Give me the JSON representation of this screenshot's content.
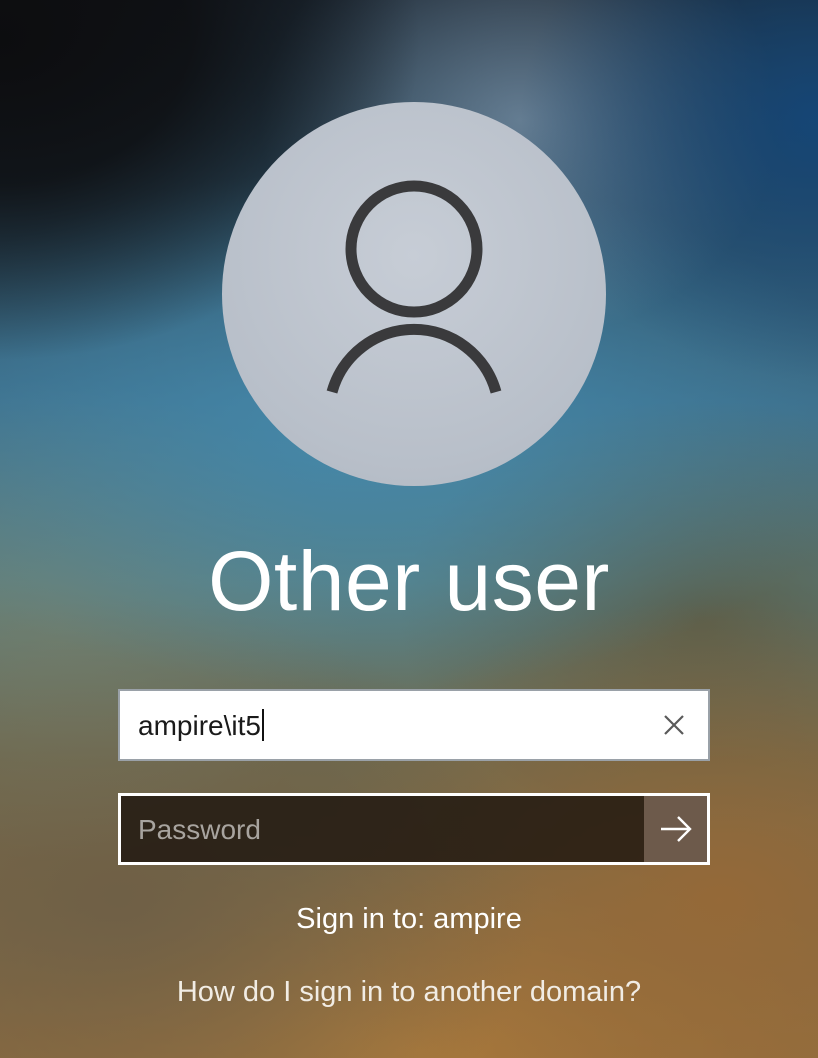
{
  "user_tile": {
    "icon": "user-avatar-icon",
    "title": "Other user"
  },
  "username_field": {
    "value": "ampire\\it5",
    "clear_icon": "close-icon"
  },
  "password_field": {
    "placeholder": "Password",
    "submit_icon": "arrow-right-icon"
  },
  "sign_in_to": "Sign in to: ampire",
  "other_domain_link": "How do I sign in to another domain?",
  "colors": {
    "avatar_bg": "#b8bfc9",
    "avatar_icon": "#3a3a3c",
    "text": "#ffffff"
  }
}
